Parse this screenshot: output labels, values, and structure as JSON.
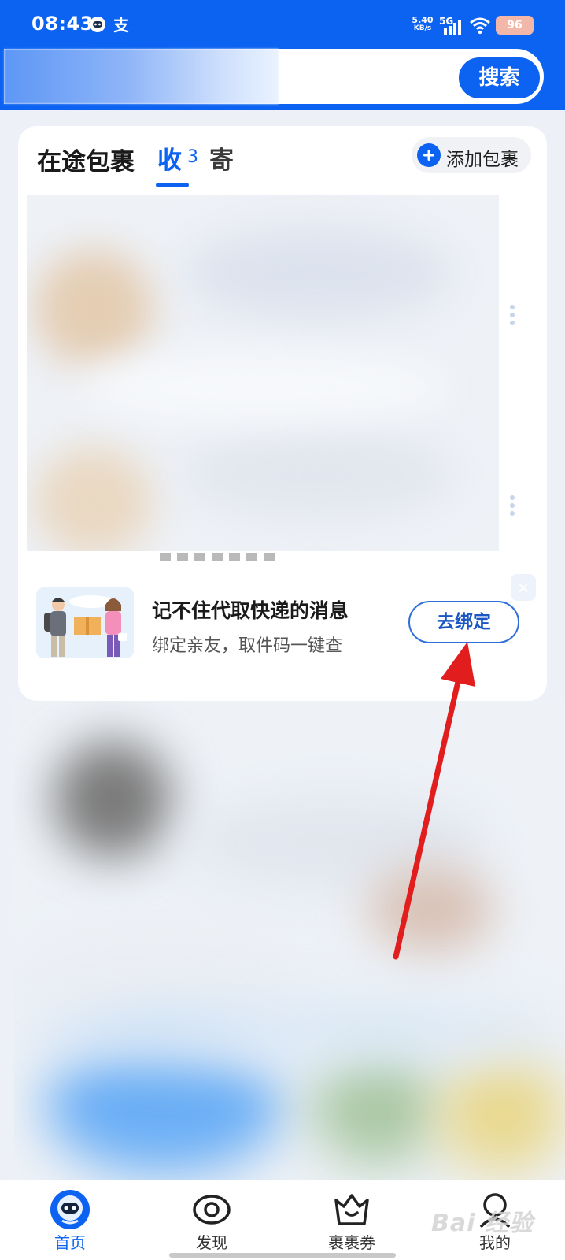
{
  "status_bar": {
    "time": "08:43",
    "alipay_glyph": "支",
    "net_speed": "5.40",
    "net_unit": "KB/s",
    "network": "5G",
    "battery": "96"
  },
  "search": {
    "button_label": "搜索"
  },
  "packages": {
    "title": "在途包裹",
    "tab_receive": "收",
    "tab_receive_count": "3",
    "tab_send": "寄",
    "add_label": "添加包裹"
  },
  "bind_banner": {
    "title": "记不住代取快递的消息",
    "subtitle": "绑定亲友，取件码一键查",
    "button_label": "去绑定",
    "close_glyph": "×"
  },
  "nav": [
    {
      "label": "首页",
      "icon": "home-robot-icon",
      "active": true
    },
    {
      "label": "发现",
      "icon": "eye-icon",
      "active": false
    },
    {
      "label": "裹裹券",
      "icon": "crown-bag-icon",
      "active": false
    },
    {
      "label": "我的",
      "icon": "profile-icon",
      "active": false
    }
  ],
  "watermark": "Bai 经验",
  "colors": {
    "brand_blue": "#0c63f2",
    "annotation_red": "#e11d1d"
  }
}
